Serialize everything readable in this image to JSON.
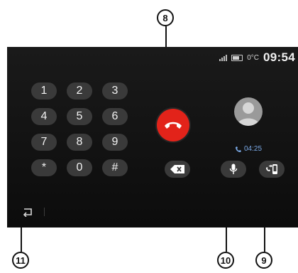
{
  "status_bar": {
    "temperature": "0°C",
    "time": "09:54"
  },
  "keypad": {
    "keys": [
      "1",
      "2",
      "3",
      "4",
      "5",
      "6",
      "7",
      "8",
      "9",
      "*",
      "0",
      "#"
    ]
  },
  "call": {
    "duration": "04:25"
  },
  "callouts": {
    "hangup": "8",
    "transfer": "9",
    "mute": "10",
    "back": "11"
  },
  "colors": {
    "hangup": "#e2231a",
    "screen_background": "#111111",
    "key_background": "#3a3a3a",
    "call_timer": "#7aa9e6"
  },
  "icons": {
    "hangup": "phone-hangup-icon",
    "backspace": "backspace-icon",
    "mute": "microphone-icon",
    "transfer": "phone-transfer-icon",
    "back": "back-arrow-icon",
    "call_active": "phone-active-icon",
    "contact": "contact-avatar-icon"
  }
}
